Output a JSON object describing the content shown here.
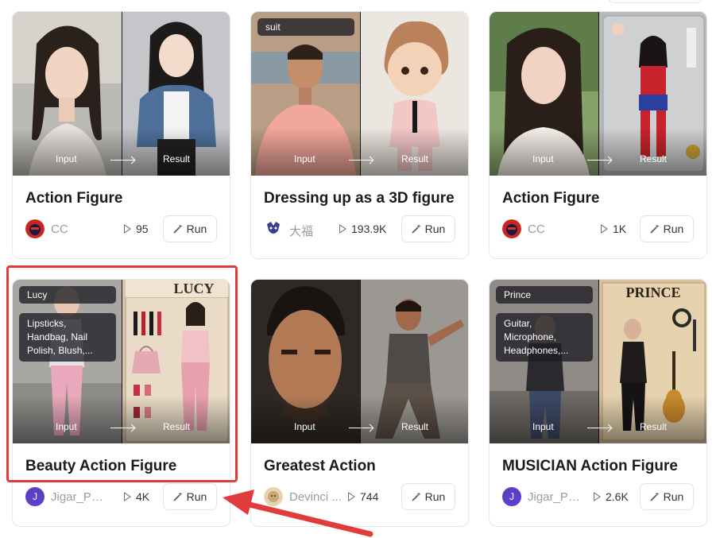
{
  "labels": {
    "input": "Input",
    "result": "Result"
  },
  "cards": [
    {
      "title": "Action Figure",
      "author": "CC",
      "plays": "95",
      "run_label": "Run"
    },
    {
      "title": "Dressing up as a 3D figure",
      "author": "大福",
      "plays": "193.9K",
      "run_label": "Run",
      "tag": "suit"
    },
    {
      "title": "Action Figure",
      "author": "CC",
      "plays": "1K",
      "run_label": "Run"
    },
    {
      "title": "Beauty Action Figure",
      "author": "Jigar_Pa...",
      "plays": "4K",
      "run_label": "Run",
      "tag": "Lucy",
      "tag_items": "Lipsticks, Handbag, Nail Polish, Blush,...",
      "box_text": "LUCY",
      "avatar_letter": "J"
    },
    {
      "title": "Greatest Action",
      "author": "Devinci ...",
      "plays": "744",
      "run_label": "Run"
    },
    {
      "title": "MUSICIAN Action Figure",
      "author": "Jigar_Pa...",
      "plays": "2.6K",
      "run_label": "Run",
      "tag": "Prince",
      "tag_items": "Guitar, Microphone, Headphones,...",
      "box_text": "PRINCE",
      "avatar_letter": "J"
    }
  ],
  "colors": {
    "highlight": "#e03c3c",
    "avatar_purple": "#5b3fc7"
  }
}
